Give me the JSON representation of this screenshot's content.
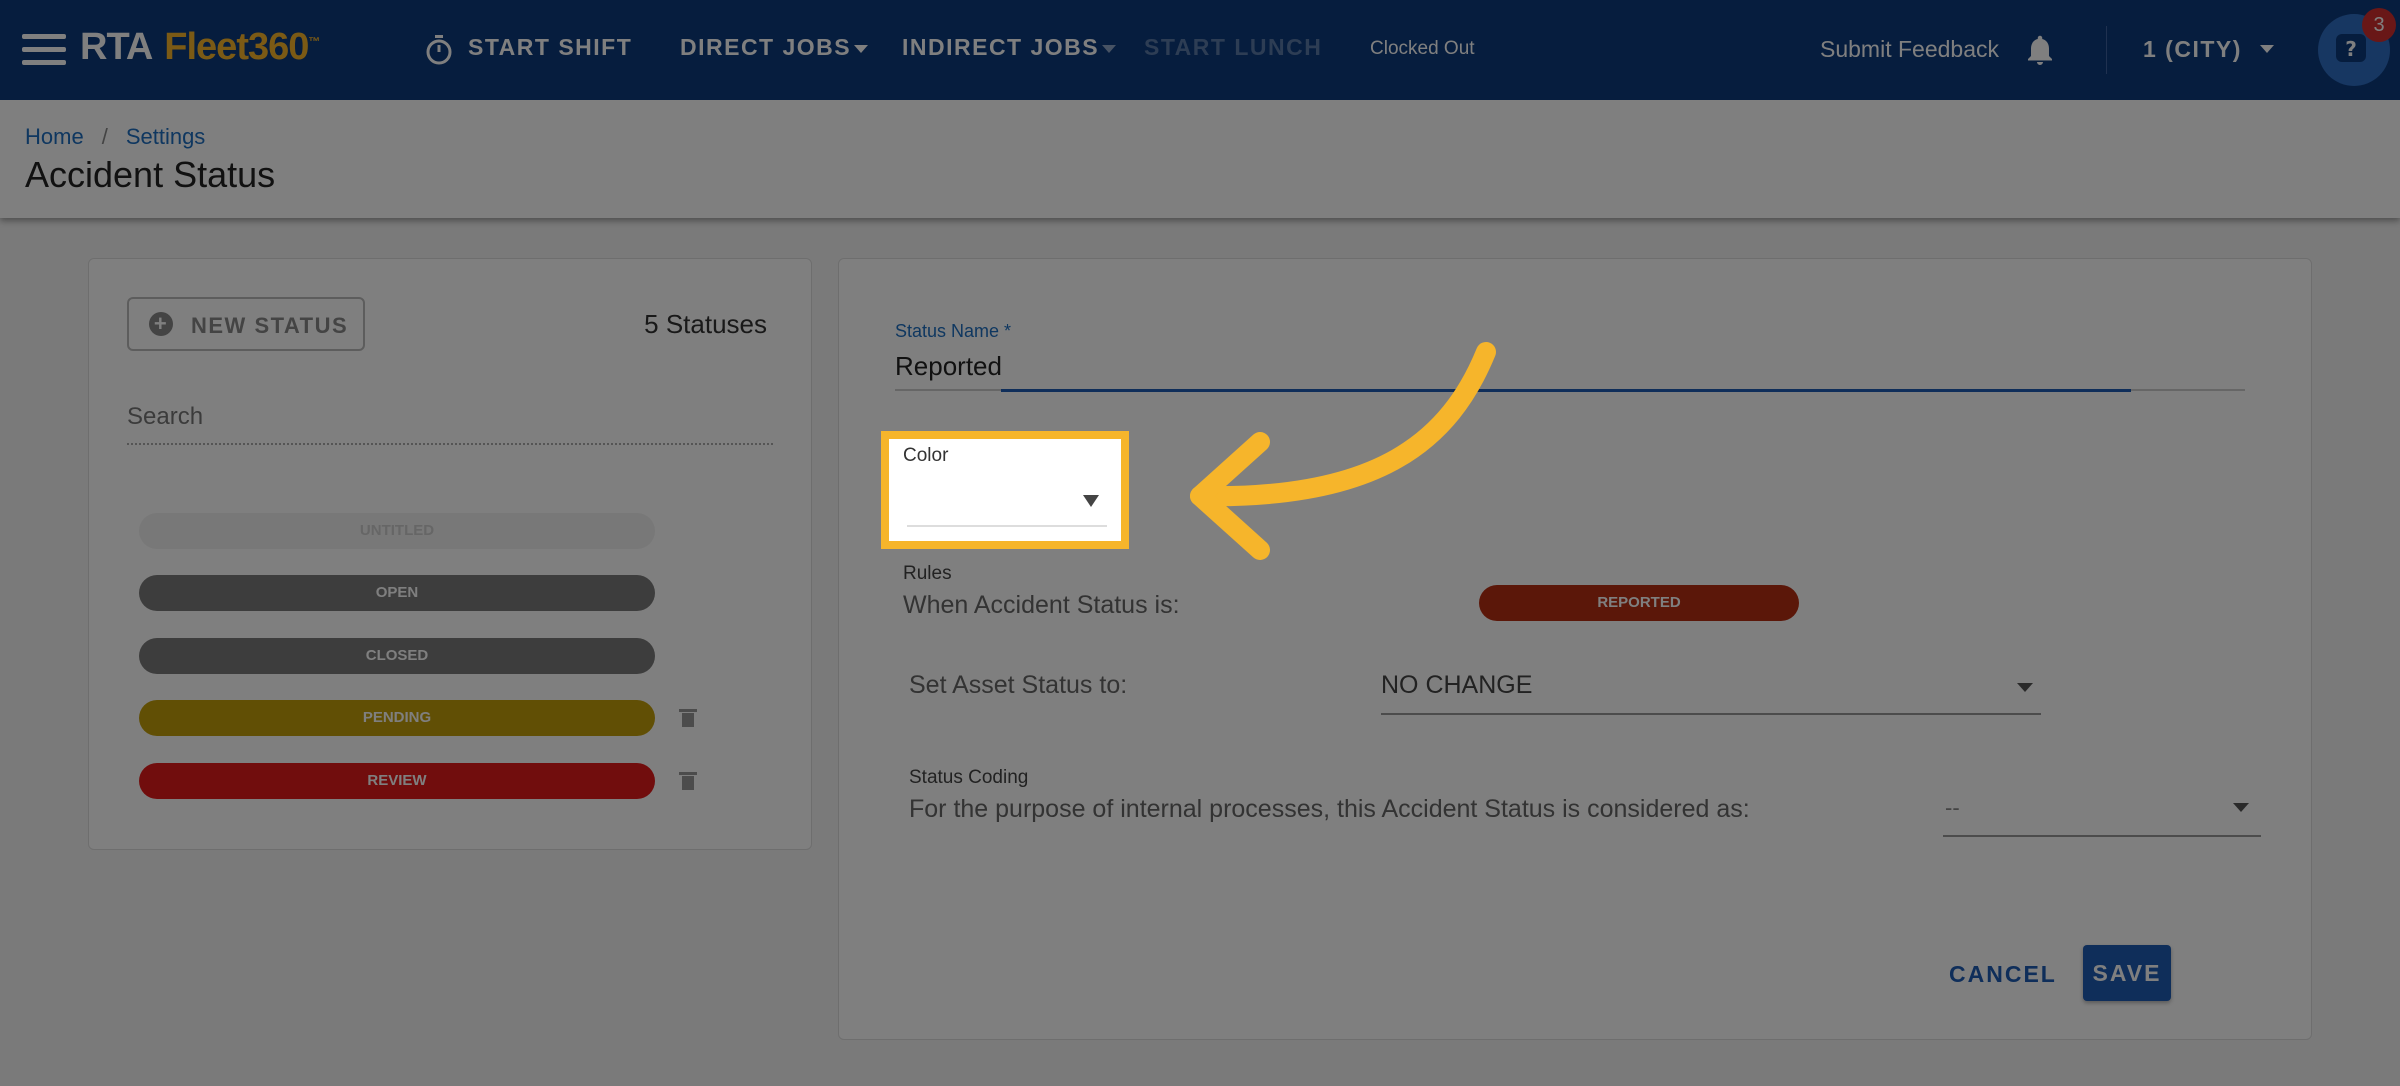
{
  "topbar": {
    "logo_prefix": "RTA",
    "logo_name": "Fleet360",
    "logo_tm": "™",
    "nav": {
      "start_shift": "START SHIFT",
      "direct_jobs": "DIRECT JOBS",
      "indirect_jobs": "INDIRECT JOBS",
      "start_lunch": "START LUNCH"
    },
    "clock_status": "Clocked Out",
    "submit_feedback": "Submit Feedback",
    "org_selector": "1 (CITY)",
    "help_badge_count": "3"
  },
  "breadcrumb": [
    "Home",
    "Settings"
  ],
  "page_title": "Accident Status",
  "left_panel": {
    "new_status_label": "NEW STATUS",
    "status_count": "5 Statuses",
    "search_placeholder": "Search",
    "statuses": [
      {
        "label": "UNTITLED",
        "color": "#f0f0f0",
        "deletable": false
      },
      {
        "label": "OPEN",
        "color": "#7a7a7a",
        "deletable": false
      },
      {
        "label": "CLOSED",
        "color": "#7a7a7a",
        "deletable": false
      },
      {
        "label": "PENDING",
        "color": "#c29e0a",
        "deletable": true
      },
      {
        "label": "REVIEW",
        "color": "#e21a1a",
        "deletable": true
      }
    ]
  },
  "form": {
    "status_name_label": "Status Name *",
    "status_name_value": "Reported",
    "color_label": "Color",
    "rules_label": "Rules",
    "rules_text": "When Accident Status is:",
    "rules_status_pill": "REPORTED",
    "rules_status_color": "#b62e13",
    "asset_label": "Set Asset Status to:",
    "asset_value": "NO CHANGE",
    "coding_label": "Status Coding",
    "coding_text": "For the purpose of internal processes, this Accident Status is considered as:",
    "coding_value": "--",
    "cancel_label": "CANCEL",
    "save_label": "SAVE"
  },
  "colors": {
    "primary_nav": "#0d3a7c",
    "accent_blue": "#1e5cb4",
    "highlight_yellow": "#f6b52b"
  }
}
